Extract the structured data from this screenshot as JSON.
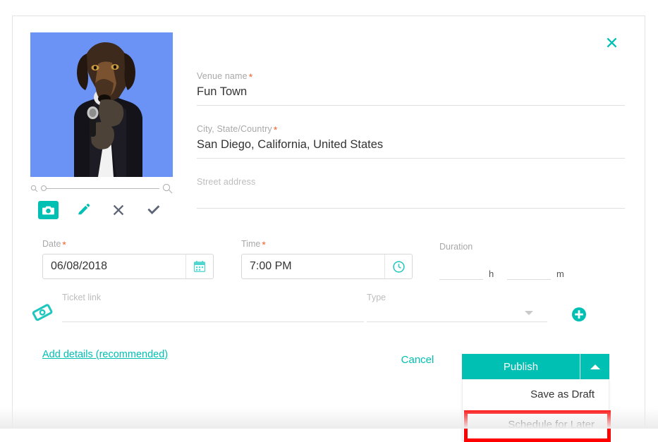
{
  "dialog": {
    "close_icon": "close-x-icon"
  },
  "photo": {
    "alt": "dog-in-suit-with-microphone",
    "background_color": "#6b92f5",
    "zoom_slider": {
      "min_icon": "magnifier-small-icon",
      "max_icon": "magnifier-large-icon",
      "value": 0
    },
    "tools": [
      {
        "name": "camera-button",
        "icon": "camera-icon",
        "active": true
      },
      {
        "name": "edit-button",
        "icon": "pencil-icon",
        "active": false
      },
      {
        "name": "remove-button",
        "icon": "x-icon",
        "active": false
      },
      {
        "name": "confirm-button",
        "icon": "check-icon",
        "active": false
      }
    ]
  },
  "form": {
    "venue": {
      "label": "Venue name",
      "required": "*",
      "value": "Fun Town"
    },
    "city": {
      "label": "City, State/Country",
      "required": "*",
      "value": "San Diego, California, United States"
    },
    "street": {
      "label": "Street address",
      "value": "",
      "placeholder": "Street address"
    },
    "date": {
      "label": "Date",
      "required": "*",
      "value": "06/08/2018",
      "icon": "calendar-icon"
    },
    "time": {
      "label": "Time",
      "required": "*",
      "value": "7:00 PM",
      "icon": "clock-icon"
    },
    "duration": {
      "label": "Duration",
      "hours_value": "",
      "hours_unit": "h",
      "minutes_value": "",
      "minutes_unit": "m"
    },
    "ticket": {
      "icon": "ticket-icon",
      "label": "Ticket link",
      "value": ""
    },
    "type": {
      "label": "Type",
      "value": "",
      "caret_icon": "chevron-down-icon"
    },
    "add_row": {
      "icon": "plus-circle-icon"
    }
  },
  "footer": {
    "add_details_label": "Add details (recommended)",
    "cancel_label": "Cancel",
    "publish_label": "Publish",
    "split_caret_icon": "chevron-up-icon",
    "menu_items": [
      {
        "label": "Save as Draft",
        "highlighted": false
      },
      {
        "label": "Schedule for Later",
        "highlighted": true
      }
    ]
  },
  "colors": {
    "accent_teal": "#00bfb3",
    "required_orange": "#f4612b",
    "highlight_red": "#ff0000",
    "photo_blue": "#6b92f5"
  }
}
